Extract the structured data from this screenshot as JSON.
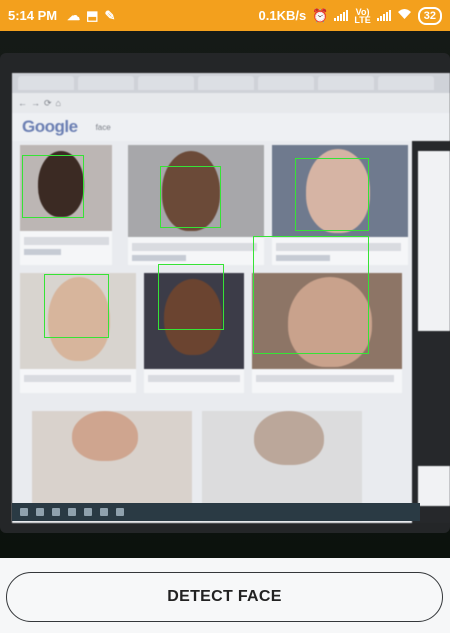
{
  "status_bar": {
    "time": "5:14 PM",
    "net_speed": "0.1KB/s",
    "volte_top": "Vo)",
    "volte_bottom": "LTE",
    "battery": "32",
    "icons": [
      "cloud-icon",
      "bookmark-icon",
      "app-icon",
      "alarm-icon",
      "signal-icon",
      "signal-icon",
      "wifi-icon",
      "battery-icon"
    ]
  },
  "camera_preview": {
    "browser_logo": "Google",
    "search_query": "face",
    "detected_faces": 7,
    "box_color": "#36e336"
  },
  "detect_button": {
    "label": "DETECT FACE"
  },
  "colors": {
    "status_bar": "#f3a01d",
    "detection_box": "#36e336",
    "button_border": "#34373a"
  }
}
